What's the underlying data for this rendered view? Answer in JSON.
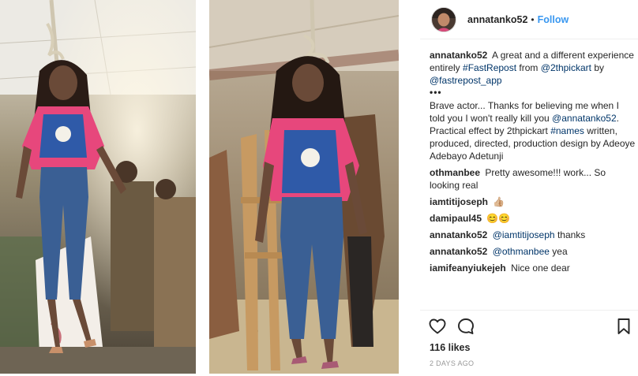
{
  "post": {
    "username": "annatanko52",
    "separator": "•",
    "follow_label": "Follow",
    "avatar_icon": "profile-photo-icon"
  },
  "comments": [
    {
      "user": "annatanko52",
      "text": "A great and a different experience entirely",
      "hashtag": "#FastRepost",
      "from_word": "from",
      "mention_1": "@2thpickart",
      "by_word": "by",
      "mention_2": "@fastrepost_app",
      "more": "•••",
      "body": "Brave actor... Thanks for believing me when I told you I won't really kill you",
      "mention_3": "@annatanko52",
      "body_2": ". Practical effect by 2thpickart",
      "hashtag_2": "#names",
      "body_3": "written, produced, directed, production design by Adeoye Adebayo Adetunji"
    },
    {
      "user": "othmanbee",
      "text": "Pretty awesome!!! work... So looking real"
    },
    {
      "user": "iamtitijoseph",
      "text": "👍🏼"
    },
    {
      "user": "damipaul45",
      "text": "😊😊"
    },
    {
      "user": "annatanko52",
      "mention": "@iamtitijoseph",
      "text": "thanks"
    },
    {
      "user": "annatanko52",
      "mention": "@othmanbee",
      "text": "yea"
    },
    {
      "user": "iamifeanyiukejeh",
      "text": "Nice one dear"
    }
  ],
  "actions": {
    "like_icon": "heart-icon",
    "comment_icon": "comment-bubble-icon",
    "save_icon": "bookmark-icon",
    "likes": "116 likes",
    "timestamp": "2 DAYS AGO"
  },
  "colors": {
    "link": "#003569",
    "follow": "#3897f0",
    "text": "#262626",
    "muted": "#999999"
  }
}
